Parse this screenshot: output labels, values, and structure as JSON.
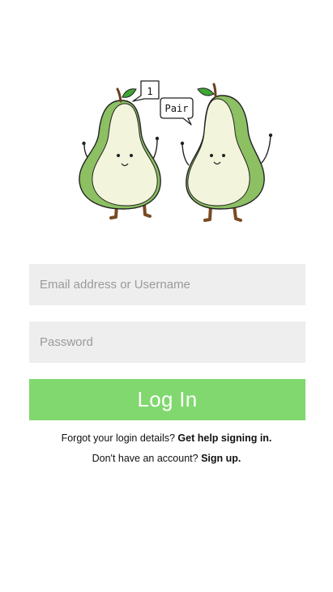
{
  "logo": {
    "bubble_left": "1",
    "bubble_right": "Pair",
    "colors": {
      "pear_outer": "#8cc063",
      "pear_inner": "#f3f4dc",
      "leaf": "#3fa535",
      "stem": "#6b3f1f",
      "legs": "#7a4a22"
    }
  },
  "login_form": {
    "email_placeholder": "Email address or Username",
    "password_placeholder": "Password",
    "login_label": "Log In"
  },
  "help": {
    "forgot_text": "Forgot your login details?",
    "forgot_link": "Get help signing in.",
    "signup_text": "Don't have an account?",
    "signup_link": "Sign up."
  },
  "colors": {
    "login_button": "#80d86f",
    "field_background": "#eeeeee"
  }
}
